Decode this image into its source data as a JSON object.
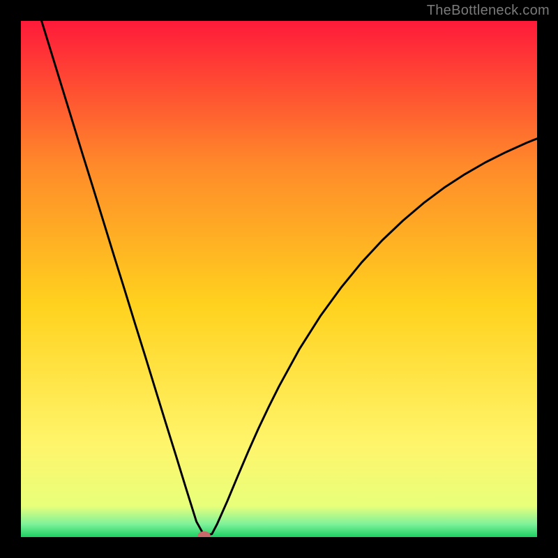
{
  "attribution": "TheBottleneck.com",
  "chart_data": {
    "type": "line",
    "title": "",
    "xlabel": "",
    "ylabel": "",
    "xlim": [
      0,
      100
    ],
    "ylim": [
      0,
      100
    ],
    "background_gradient": {
      "bottom": "#1ccf63",
      "mid_low": "#e8ff7a",
      "mid": "#ffd21e",
      "mid_high": "#ff8a2a",
      "top": "#ff1a3a"
    },
    "series": [
      {
        "name": "bottleneck-curve",
        "color": "#000000",
        "x": [
          4,
          6,
          8,
          10,
          12,
          14,
          16,
          18,
          20,
          22,
          24,
          26,
          28,
          30,
          32,
          34,
          35.5,
          37,
          38,
          40,
          42,
          44,
          46,
          48,
          50,
          54,
          58,
          62,
          66,
          70,
          74,
          78,
          82,
          86,
          90,
          94,
          98,
          100
        ],
        "y": [
          100,
          93.5,
          87,
          80.5,
          74,
          67.6,
          61.1,
          54.6,
          48.2,
          41.7,
          35.3,
          28.8,
          22.3,
          15.9,
          9.4,
          3.0,
          0.3,
          0.6,
          2.5,
          7.0,
          11.8,
          16.5,
          21.0,
          25.2,
          29.2,
          36.5,
          42.8,
          48.3,
          53.2,
          57.5,
          61.3,
          64.7,
          67.7,
          70.3,
          72.6,
          74.6,
          76.4,
          77.2
        ]
      }
    ],
    "marker": {
      "name": "optimal-point",
      "x": 35.5,
      "y": 0.3,
      "color": "#c96a6a"
    }
  }
}
